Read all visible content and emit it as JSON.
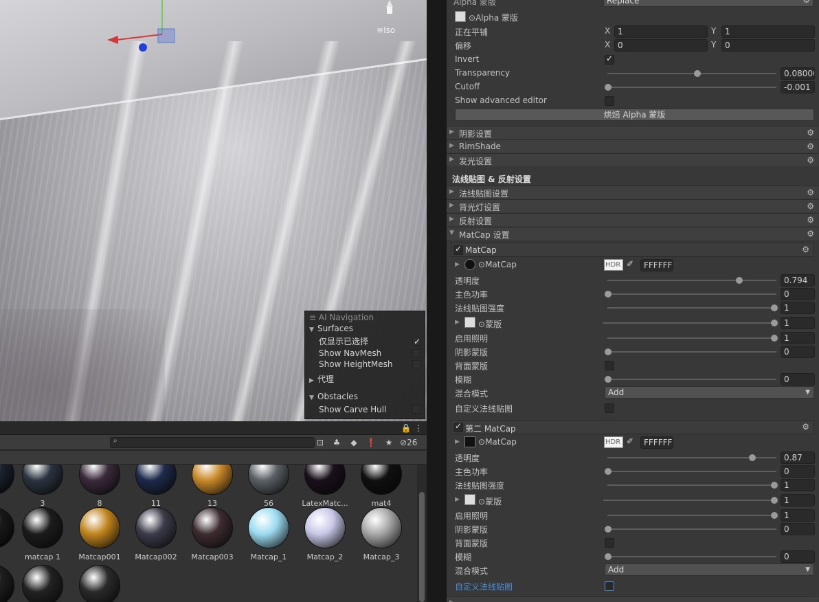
{
  "scene": {
    "iso_label": "Iso",
    "nav_overlay": {
      "title": "AI Navigation",
      "surfaces": "Surfaces",
      "show_selected_only": "仅显示已选择",
      "show_navmesh": "Show NavMesh",
      "show_heightmesh": "Show HeightMesh",
      "agents": "代理",
      "obstacles": "Obstacles",
      "show_carve_hull": "Show Carve Hull"
    }
  },
  "project": {
    "hidden_count": "26",
    "rows": [
      [
        {
          "name": "3",
          "color": "#2a3440"
        },
        {
          "name": "8",
          "color": "#3a2a3a"
        },
        {
          "name": "11",
          "color": "#1e2a4a"
        },
        {
          "name": "13",
          "color": "#c98a2a"
        },
        {
          "name": "56",
          "color": "#5a6066"
        },
        {
          "name": "LatexMatc...",
          "color": "#1a0f1c"
        },
        {
          "name": "mat4",
          "color": "#101010"
        }
      ],
      [
        {
          "name": "matcap 1",
          "color": "#1c1c1c"
        },
        {
          "name": "Matcap001",
          "color": "#c0851e"
        },
        {
          "name": "Matcap002",
          "color": "#3c3c4a"
        },
        {
          "name": "Matcap003",
          "color": "#3c2c30"
        },
        {
          "name": "Matcap_1",
          "color": "#9cdcf0"
        },
        {
          "name": "Matcap_2",
          "color": "#c8c8e8"
        },
        {
          "name": "Matcap_3",
          "color": "#a8a8a8"
        }
      ],
      [
        {
          "name": "",
          "color": "#222222"
        },
        {
          "name": "",
          "color": "#2a2a2a"
        }
      ]
    ]
  },
  "inspector": {
    "alpha_mask_label": "Alpha 蒙版",
    "alpha_mask_mode": "Replace",
    "alpha_tex_label": "Alpha 蒙版",
    "tiling_label": "正在平铺",
    "tiling_x": "1",
    "tiling_y": "1",
    "offset_label": "偏移",
    "offset_x": "0",
    "offset_y": "0",
    "invert_label": "Invert",
    "transparency_label": "Transparency",
    "transparency_value": "0.08000",
    "cutoff_label": "Cutoff",
    "cutoff_value": "-0.001",
    "show_adv_label": "Show advanced editor",
    "bake_button": "烘焙 Alpha 蒙版",
    "x_label": "X",
    "y_label": "Y",
    "sections_top": [
      "阴影设置",
      "RimShade",
      "发光设置"
    ],
    "normal_reflection_title": "法线贴图 & 反射设置",
    "sections_mid": [
      "法线贴图设置",
      "背光灯设置",
      "反射设置"
    ],
    "matcap_settings": "MatCap 设置",
    "matcap1": {
      "header": "MatCap",
      "tex_label": "MatCap",
      "hdr": "HDR",
      "hex": "FFFFFF",
      "opacity_label": "透明度",
      "opacity_value": "0.794",
      "main_color_power_label": "主色功率",
      "main_color_power_value": "0",
      "normal_strength_label": "法线贴图强度",
      "normal_strength_value": "1",
      "mask_label": "蒙版",
      "mask_value": "1",
      "lighting_label": "启用照明",
      "lighting_value": "1",
      "shadow_mask_label": "阴影蒙版",
      "shadow_mask_value": "0",
      "backface_label": "背面蒙版",
      "blur_label": "模糊",
      "blur_value": "0",
      "blend_label": "混合模式",
      "blend_value": "Add",
      "custom_normal_label": "自定义法线贴图"
    },
    "matcap2": {
      "header": "第二 MatCap",
      "tex_label": "MatCap",
      "hdr": "HDR",
      "hex": "FFFFFF",
      "opacity_label": "透明度",
      "opacity_value": "0.87",
      "main_color_power_label": "主色功率",
      "main_color_power_value": "0",
      "normal_strength_label": "法线贴图强度",
      "normal_strength_value": "1",
      "mask_label": "蒙版",
      "mask_value": "1",
      "lighting_label": "启用照明",
      "lighting_value": "1",
      "shadow_mask_label": "阴影蒙版",
      "shadow_mask_value": "0",
      "backface_label": "背面蒙版",
      "blur_label": "模糊",
      "blur_value": "0",
      "blend_label": "混合模式",
      "blend_value": "Add",
      "custom_normal_label": "自定义法线贴图"
    },
    "accent_color": "#4d8ed8"
  }
}
